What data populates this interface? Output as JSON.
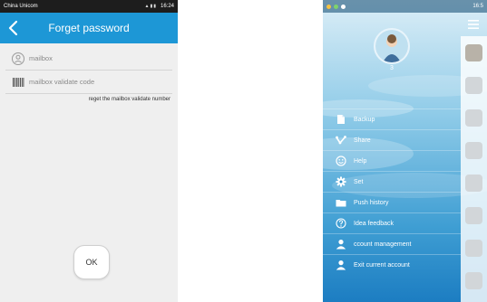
{
  "left_phone": {
    "status_bar": {
      "carrier": "China Unicom",
      "time": "16:24"
    },
    "header": {
      "title": "Forget password",
      "back_icon": "chevron-left-icon"
    },
    "form": {
      "mailbox_label": "mailbox",
      "mailbox_icon": "user-circle-icon",
      "validate_code_label": "mailbox validate code",
      "validate_code_icon": "barcode-icon",
      "reget_link": "reget the mailbox validate number"
    },
    "ok_button": "OK",
    "colors": {
      "header": "#1d97d6",
      "background": "#efefef"
    }
  },
  "right_phone": {
    "status_bar": {
      "time": "16:5"
    },
    "profile": {
      "name": "3"
    },
    "menu": [
      {
        "label": "Backup",
        "icon": "document-icon"
      },
      {
        "label": "Share",
        "icon": "share-icon"
      },
      {
        "label": "Help",
        "icon": "smiley-icon"
      },
      {
        "label": "Set",
        "icon": "gear-icon"
      },
      {
        "label": "Push history",
        "icon": "folder-icon"
      },
      {
        "label": "Idea feedback",
        "icon": "question-icon"
      },
      {
        "label": "ccount management",
        "icon": "person-icon"
      },
      {
        "label": "Exit current account",
        "icon": "person-icon"
      }
    ],
    "colors": {
      "drawer_top": "#dceef7",
      "drawer_bottom": "#1c7dc2"
    }
  }
}
